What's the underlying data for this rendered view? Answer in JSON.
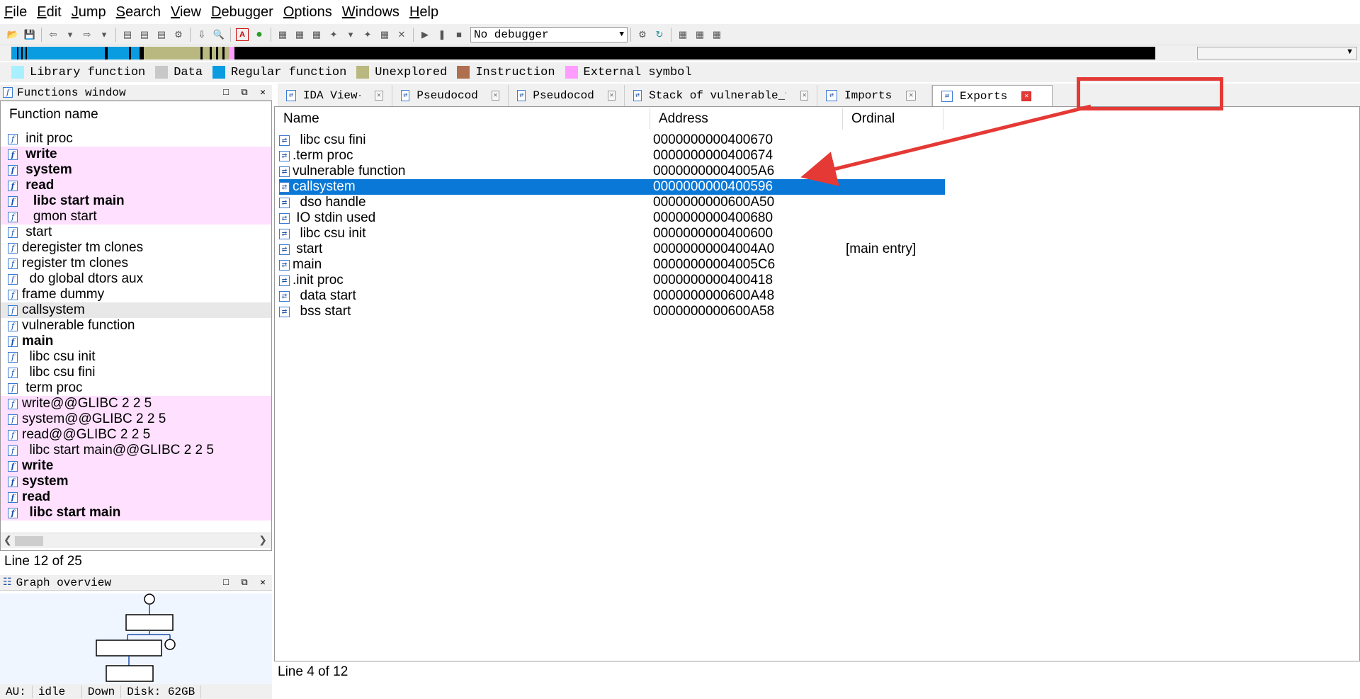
{
  "menu": [
    "File",
    "Edit",
    "Jump",
    "Search",
    "View",
    "Debugger",
    "Options",
    "Windows",
    "Help"
  ],
  "menu_underline": [
    "F",
    "E",
    "J",
    "S",
    "V",
    "D",
    "O",
    "W",
    "H"
  ],
  "toolbar": {
    "debugger_select": "No debugger"
  },
  "legend": [
    {
      "label": "Library function",
      "color": "#a8f0ff"
    },
    {
      "label": "Data",
      "color": "#c8c8c8"
    },
    {
      "label": "Regular function",
      "color": "#0a9ce0"
    },
    {
      "label": "Unexplored",
      "color": "#b8b880"
    },
    {
      "label": "Instruction",
      "color": "#b07050"
    },
    {
      "label": "External symbol",
      "color": "#ff9cff"
    }
  ],
  "functions_window": {
    "title": "Functions window",
    "header": "Function name",
    "rows": [
      {
        "name": " init proc",
        "style": "normal"
      },
      {
        "name": " write",
        "style": "lib-bold"
      },
      {
        "name": " system",
        "style": "lib-bold"
      },
      {
        "name": " read",
        "style": "lib-bold"
      },
      {
        "name": "   libc start main",
        "style": "lib-bold"
      },
      {
        "name": "   gmon start",
        "style": "lib"
      },
      {
        "name": " start",
        "style": "normal"
      },
      {
        "name": "deregister tm clones",
        "style": "normal"
      },
      {
        "name": "register tm clones",
        "style": "normal"
      },
      {
        "name": "  do global dtors aux",
        "style": "normal"
      },
      {
        "name": "frame dummy",
        "style": "normal"
      },
      {
        "name": "callsystem",
        "style": "sel"
      },
      {
        "name": "vulnerable function",
        "style": "normal"
      },
      {
        "name": "main",
        "style": "bold"
      },
      {
        "name": "  libc csu init",
        "style": "normal"
      },
      {
        "name": "  libc csu fini",
        "style": "normal"
      },
      {
        "name": " term proc",
        "style": "normal"
      },
      {
        "name": "write@@GLIBC 2 2 5",
        "style": "lib"
      },
      {
        "name": "system@@GLIBC 2 2 5",
        "style": "lib"
      },
      {
        "name": "read@@GLIBC 2 2 5",
        "style": "lib"
      },
      {
        "name": "  libc start main@@GLIBC 2 2 5",
        "style": "lib"
      },
      {
        "name": "write",
        "style": "lib-bold"
      },
      {
        "name": "system",
        "style": "lib-bold"
      },
      {
        "name": "read",
        "style": "lib-bold"
      },
      {
        "name": "  libc start main",
        "style": "lib-bold"
      }
    ],
    "status": "Line 12 of 25"
  },
  "graph_overview": {
    "title": "Graph overview"
  },
  "au_bar": {
    "au": "AU:",
    "state": "idle",
    "dir": "Down",
    "disk": "Disk: 62GB"
  },
  "tabs": [
    {
      "label": "IDA View-A",
      "active": false
    },
    {
      "label": "Pseudocode-B",
      "active": false
    },
    {
      "label": "Pseudocode-A",
      "active": false
    },
    {
      "label": "Stack of vulnerable_function",
      "active": false
    },
    {
      "label": "Imports",
      "active": false
    },
    {
      "label": "Exports",
      "active": true
    }
  ],
  "exports": {
    "columns": [
      "Name",
      "Address",
      "Ordinal"
    ],
    "rows": [
      {
        "name": "  libc csu fini",
        "address": "0000000000400670",
        "ordinal": ""
      },
      {
        "name": ".term proc",
        "address": "0000000000400674",
        "ordinal": ""
      },
      {
        "name": "vulnerable function",
        "address": "00000000004005A6",
        "ordinal": ""
      },
      {
        "name": "callsystem",
        "address": "0000000000400596",
        "ordinal": "",
        "selected": true
      },
      {
        "name": "  dso handle",
        "address": "0000000000600A50",
        "ordinal": ""
      },
      {
        "name": " IO stdin used",
        "address": "0000000000400680",
        "ordinal": ""
      },
      {
        "name": "  libc csu init",
        "address": "0000000000400600",
        "ordinal": ""
      },
      {
        "name": " start",
        "address": "00000000004004A0",
        "ordinal": "[main entry]"
      },
      {
        "name": "main",
        "address": "00000000004005C6",
        "ordinal": ""
      },
      {
        "name": ".init proc",
        "address": "0000000000400418",
        "ordinal": ""
      },
      {
        "name": "  data start",
        "address": "0000000000600A48",
        "ordinal": ""
      },
      {
        "name": "  bss start",
        "address": "0000000000600A58",
        "ordinal": ""
      }
    ],
    "status": "Line 4 of 12"
  }
}
